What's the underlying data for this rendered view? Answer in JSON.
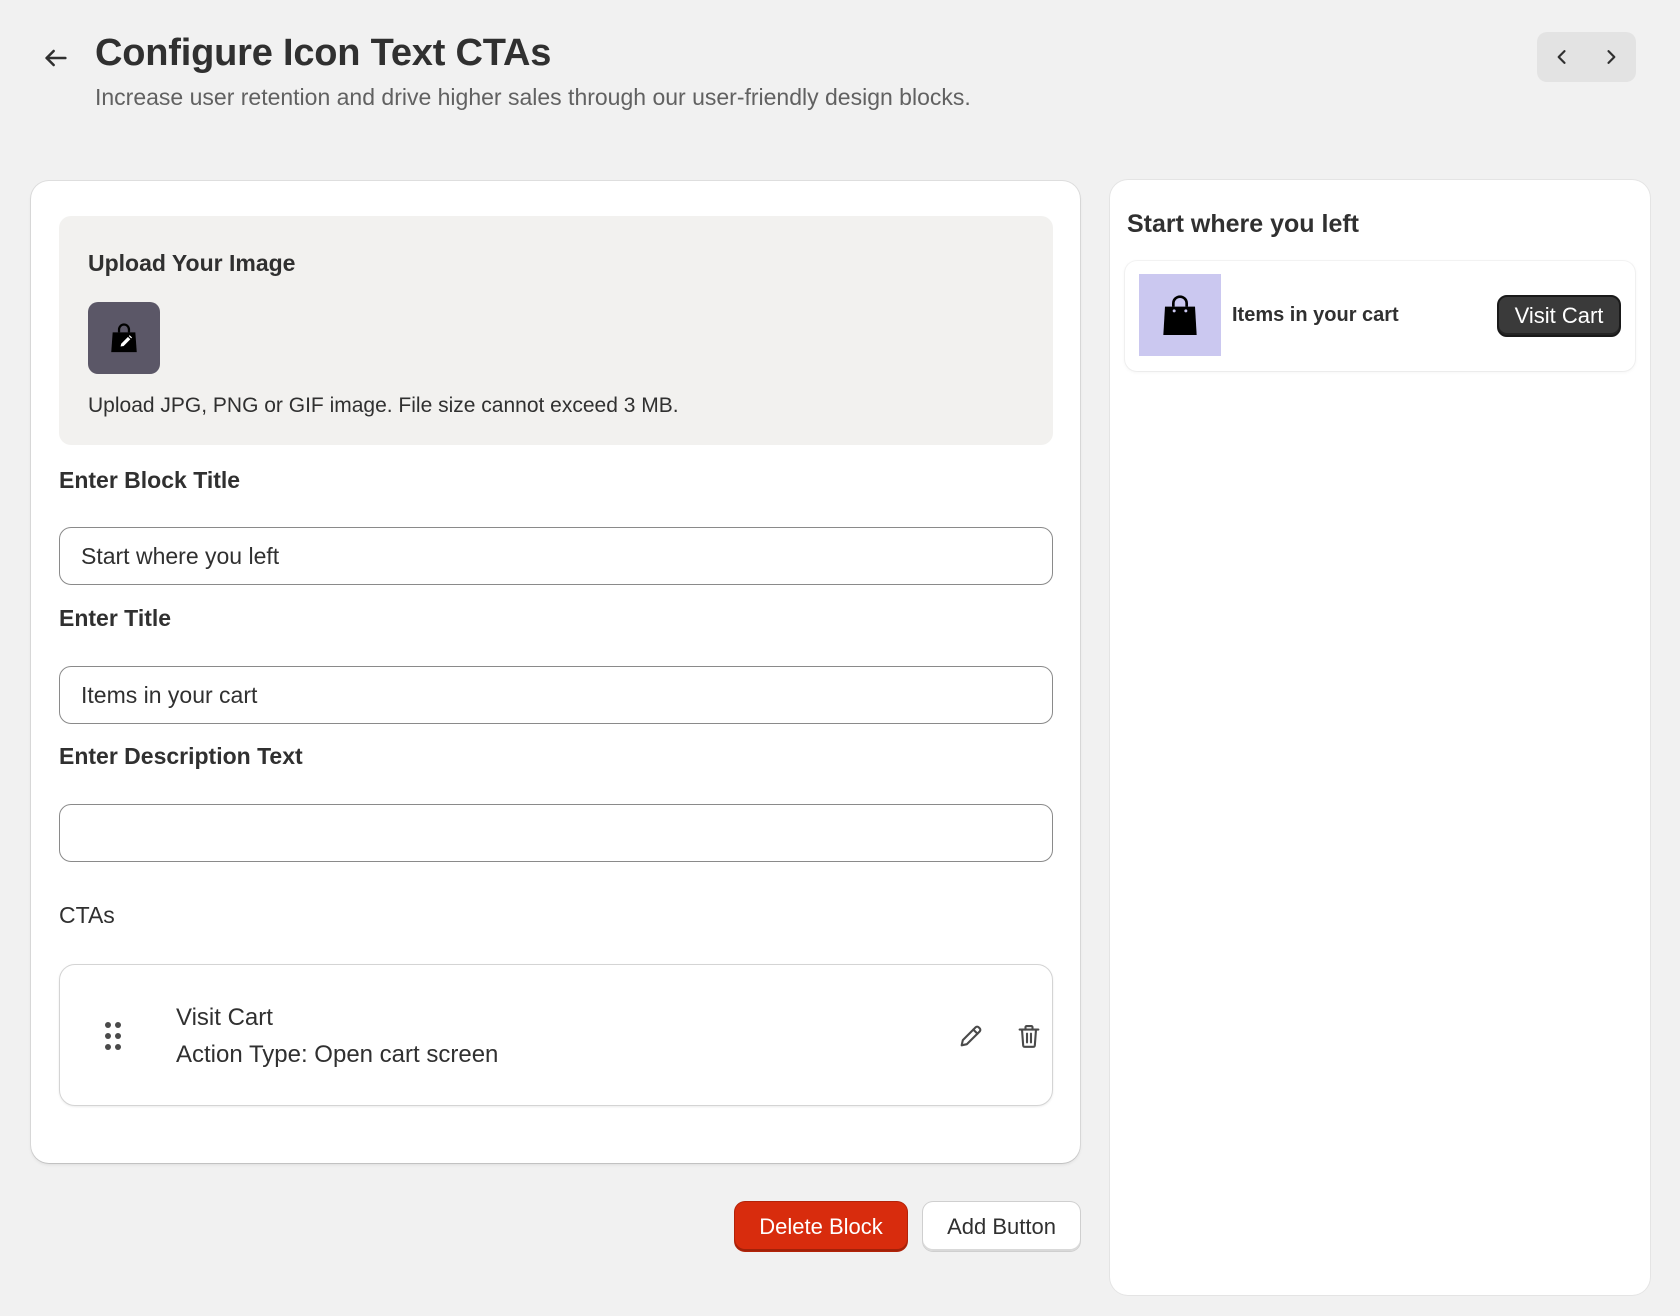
{
  "header": {
    "title": "Configure Icon Text CTAs",
    "subtitle": "Increase user retention and drive higher sales through our user-friendly design blocks.",
    "back_icon": "arrow-left-icon",
    "prev_icon": "chevron-left-icon",
    "next_icon": "chevron-right-icon"
  },
  "upload": {
    "title": "Upload Your Image",
    "hint": "Upload JPG, PNG or GIF image. File size cannot exceed 3 MB.",
    "thumb_icon": "shopping-bag-edit-icon"
  },
  "fields": {
    "block_title": {
      "label": "Enter Block Title",
      "value": "Start where you left"
    },
    "title": {
      "label": "Enter Title",
      "value": "Items in your cart"
    },
    "description": {
      "label": "Enter Description Text",
      "value": ""
    }
  },
  "ctas": {
    "label": "CTAs",
    "items": [
      {
        "title": "Visit Cart",
        "subtitle": "Action Type: Open cart screen"
      }
    ]
  },
  "actions": {
    "delete_label": "Delete Block",
    "add_label": "Add Button"
  },
  "preview": {
    "block_title": "Start where you left",
    "item_title": "Items in your cart",
    "cta_label": "Visit Cart",
    "image_bg": "#cbc8f0"
  },
  "colors": {
    "danger": "#d82c0d",
    "background": "#f1f1f1",
    "preview_button": "#3a3a3a"
  }
}
